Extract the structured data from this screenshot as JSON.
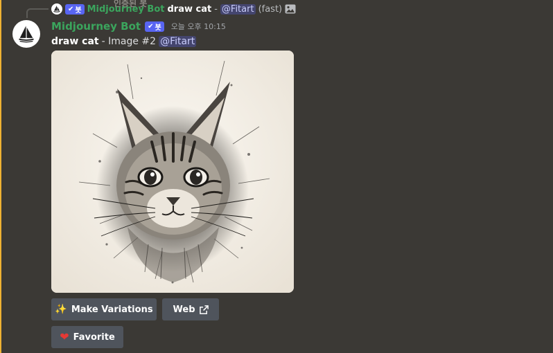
{
  "reply": {
    "tooltip_ghost": "인증된 봇",
    "author": "Midjourney Bot",
    "bot_tag": "봇",
    "command": "draw cat",
    "separator": "-",
    "mention": "@Fitart",
    "speed": "(fast)",
    "attachment_icon": "image-icon"
  },
  "message": {
    "author": "Midjourney Bot",
    "author_color": "#3ba55d",
    "bot_tag": "봇",
    "timestamp": "오늘 오후 10:15",
    "command": "draw cat",
    "rest": "- Image #2",
    "mention": "@Fitart",
    "image_subject": "ink sketch of a long-haired cat face"
  },
  "buttons": {
    "variations": {
      "icon": "sparkles-icon",
      "label": "Make Variations"
    },
    "web": {
      "label": "Web",
      "icon": "external-link-icon"
    },
    "favorite": {
      "icon": "heart-icon",
      "label": "Favorite"
    }
  },
  "colors": {
    "background": "#3b3935",
    "highlight_bar": "#f0b232",
    "bot_tag": "#5865f2",
    "button": "#4f545c"
  }
}
